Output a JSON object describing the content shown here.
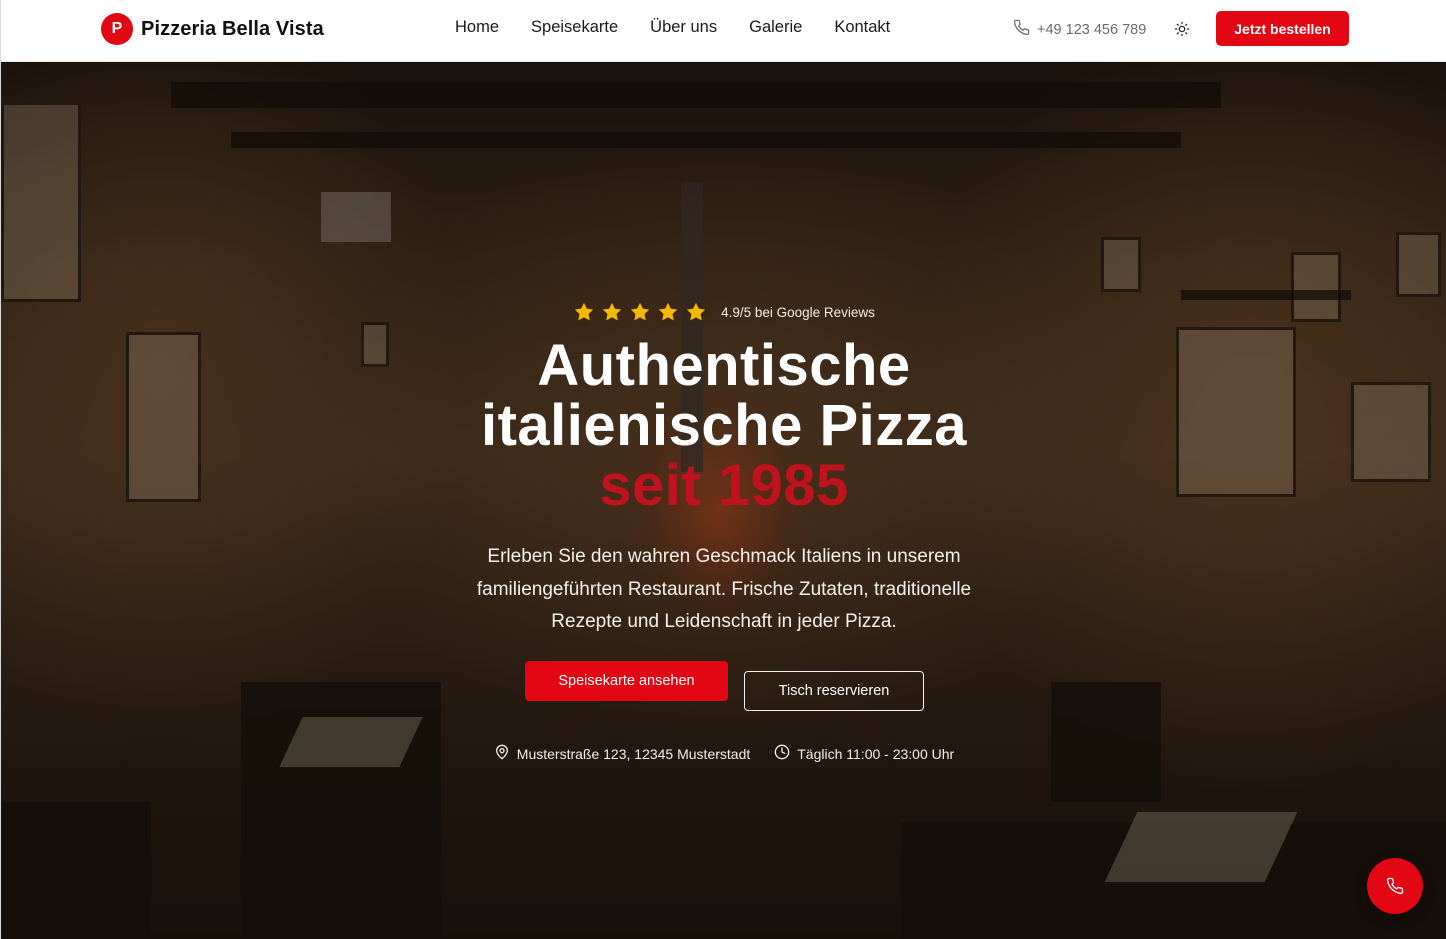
{
  "header": {
    "logo_letter": "P",
    "brand_name": "Pizzeria Bella Vista",
    "nav": [
      {
        "label": "Home"
      },
      {
        "label": "Speisekarte"
      },
      {
        "label": "Über uns"
      },
      {
        "label": "Galerie"
      },
      {
        "label": "Kontakt"
      }
    ],
    "phone": "+49 123 456 789",
    "order_button": "Jetzt bestellen"
  },
  "hero": {
    "rating": {
      "stars": 5,
      "text": "4.9/5 bei Google Reviews"
    },
    "headline_line1": "Authentische",
    "headline_line2": "italienische Pizza",
    "headline_accent": "seit 1985",
    "subtitle": "Erleben Sie den wahren Geschmack Italiens in unserem familiengeführten Restaurant. Frische Zutaten, traditionelle Rezepte und Leidenschaft in jeder Pizza.",
    "primary_button": "Speisekarte ansehen",
    "secondary_button": "Tisch reservieren",
    "address": "Musterstraße 123, 12345 Musterstadt",
    "hours": "Täglich 11:00 - 23:00 Uhr"
  },
  "colors": {
    "brand_red": "#e30613",
    "accent_red": "#c1121f",
    "star_yellow": "#f5b800"
  },
  "icons": {
    "phone": "phone-icon",
    "theme": "sun-icon",
    "star": "star-icon",
    "location": "map-pin-icon",
    "clock": "clock-icon",
    "call_fab": "phone-icon"
  }
}
